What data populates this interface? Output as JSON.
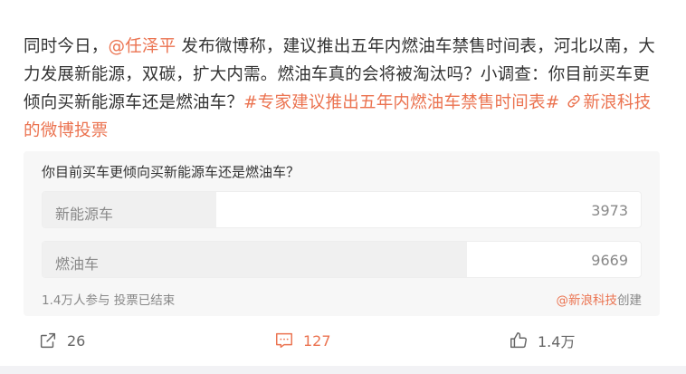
{
  "post": {
    "text_part1": "同时今日，",
    "mention": "@任泽平",
    "text_part2": " 发布微博称，建议推出五年内燃油车禁售时间表，河北以南，大力发展新能源，双碳，扩大内需。燃油车真的会将被淘汰吗？小调查：你目前买车更倾向买新能源车还是燃油车？",
    "hashtag": "#专家建议推出五年内燃油车禁售时间表#",
    "vote_link": "新浪科技的微博投票"
  },
  "poll": {
    "question": "你目前买车更倾向买新能源车还是燃油车？",
    "options": [
      {
        "label": "新能源车",
        "count": "3973",
        "share": 0.29
      },
      {
        "label": "燃油车",
        "count": "9669",
        "share": 0.71
      }
    ],
    "participants": "1.4万人参与",
    "status": "投票已结束",
    "creator": "@新浪科技",
    "created_label": "创建"
  },
  "actions": {
    "share_count": "26",
    "comment_count": "127",
    "like_count": "1.4万"
  },
  "colors": {
    "accent": "#eb7350",
    "text": "#333333",
    "muted": "#888888"
  },
  "icons": {
    "share": "share-icon",
    "comment": "comment-icon",
    "like": "thumbs-up-icon",
    "link": "link-icon"
  }
}
